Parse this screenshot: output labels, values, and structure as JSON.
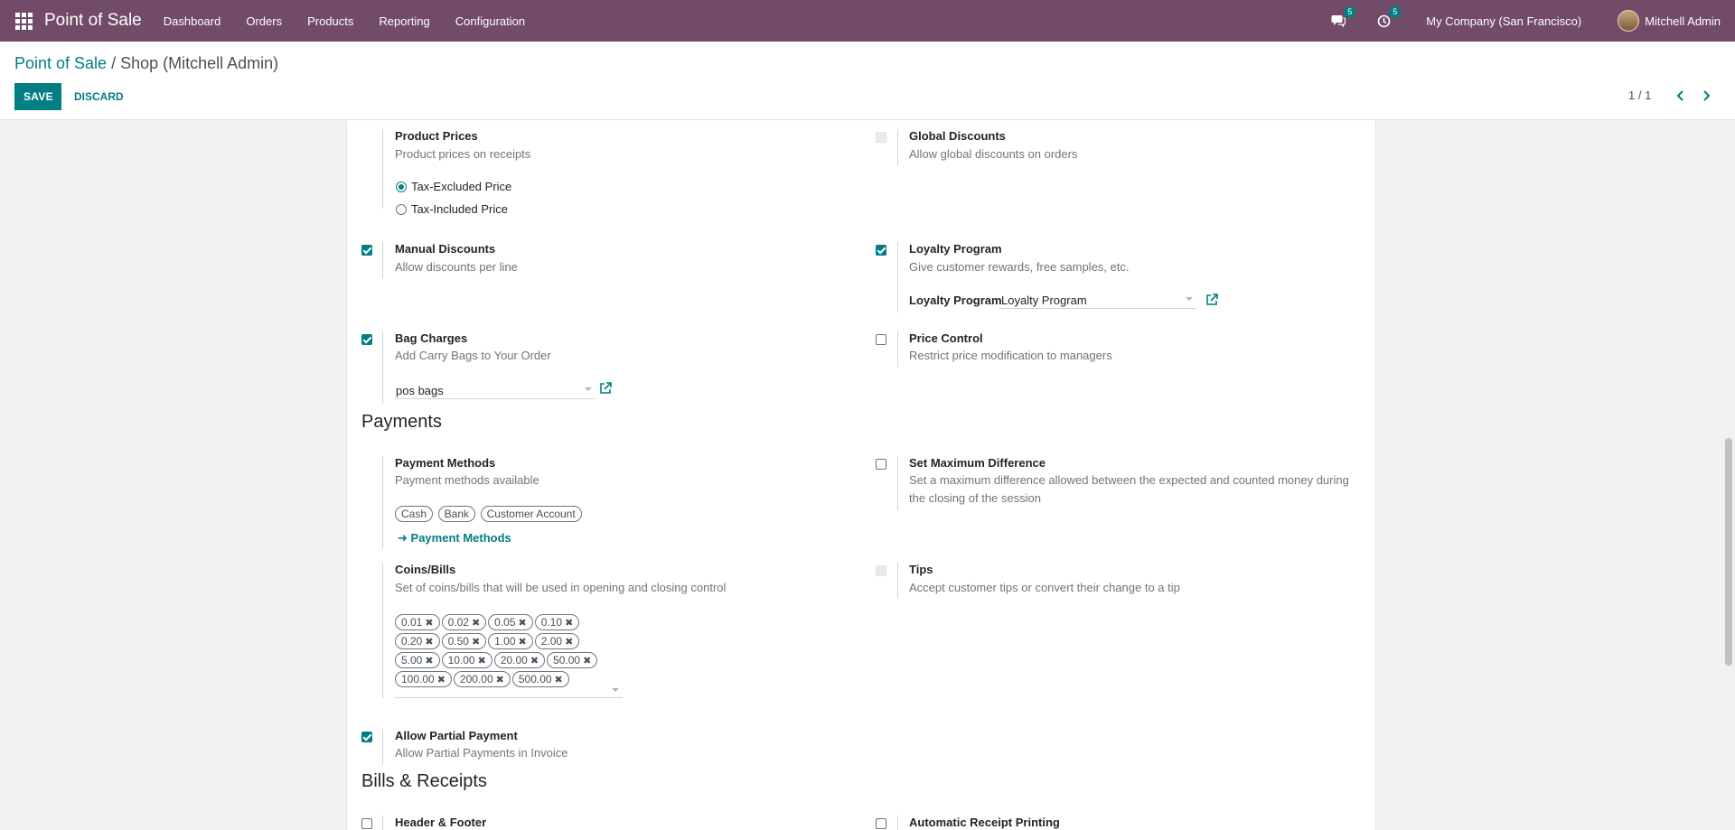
{
  "navbar": {
    "brand": "Point of Sale",
    "menu": [
      "Dashboard",
      "Orders",
      "Products",
      "Reporting",
      "Configuration"
    ],
    "messages_count": "5",
    "activities_count": "5",
    "company": "My Company (San Francisco)",
    "user": "Mitchell Admin"
  },
  "breadcrumb": {
    "parent": "Point of Sale",
    "separator": " / ",
    "current": "Shop (Mitchell Admin)"
  },
  "actions": {
    "save": "SAVE",
    "discard": "DISCARD"
  },
  "pager": {
    "value": "1 / 1"
  },
  "settings": {
    "product_prices": {
      "title": "Product Prices",
      "desc": "Product prices on receipts",
      "options": [
        "Tax-Excluded Price",
        "Tax-Included Price"
      ],
      "selected": "Tax-Excluded Price"
    },
    "global_discounts": {
      "title": "Global Discounts",
      "desc": "Allow global discounts on orders",
      "checked": false,
      "disabled": true
    },
    "manual_discounts": {
      "title": "Manual Discounts",
      "desc": "Allow discounts per line",
      "checked": true
    },
    "loyalty_program": {
      "title": "Loyalty Program",
      "desc": "Give customer rewards, free samples, etc.",
      "checked": true,
      "field_label": "Loyalty Program",
      "field_value": "Loyalty Program"
    },
    "bag_charges": {
      "title": "Bag Charges",
      "desc": "Add Carry Bags to Your Order",
      "checked": true,
      "field_value": "pos bags"
    },
    "price_control": {
      "title": "Price Control",
      "desc": "Restrict price modification to managers",
      "checked": false
    }
  },
  "payments": {
    "heading": "Payments",
    "payment_methods": {
      "title": "Payment Methods",
      "desc": "Payment methods available",
      "tags": [
        "Cash",
        "Bank",
        "Customer Account"
      ],
      "link": "Payment Methods"
    },
    "max_difference": {
      "title": "Set Maximum Difference",
      "desc_line1": "Set a maximum difference allowed between the expected and counted money during",
      "desc_line2": "the closing of the session",
      "checked": false
    },
    "coins_bills": {
      "title": "Coins/Bills",
      "desc": "Set of coins/bills that will be used in opening and closing control",
      "rows": [
        [
          "0.01",
          "0.02",
          "0.05",
          "0.10"
        ],
        [
          "0.20",
          "0.50",
          "1.00",
          "2.00"
        ],
        [
          "5.00",
          "10.00",
          "20.00",
          "50.00"
        ],
        [
          "100.00",
          "200.00",
          "500.00"
        ]
      ]
    },
    "tips": {
      "title": "Tips",
      "desc": "Accept customer tips or convert their change to a tip",
      "checked": false,
      "disabled": true
    },
    "partial_payment": {
      "title": "Allow Partial Payment",
      "desc": "Allow Partial Payments in Invoice",
      "checked": true
    }
  },
  "bills_receipts": {
    "heading": "Bills & Receipts",
    "header_footer": {
      "title": "Header & Footer",
      "checked": false
    },
    "auto_print": {
      "title": "Automatic Receipt Printing",
      "checked": false
    }
  },
  "colors": {
    "navbar": "#714b67",
    "primary": "#017e84"
  }
}
